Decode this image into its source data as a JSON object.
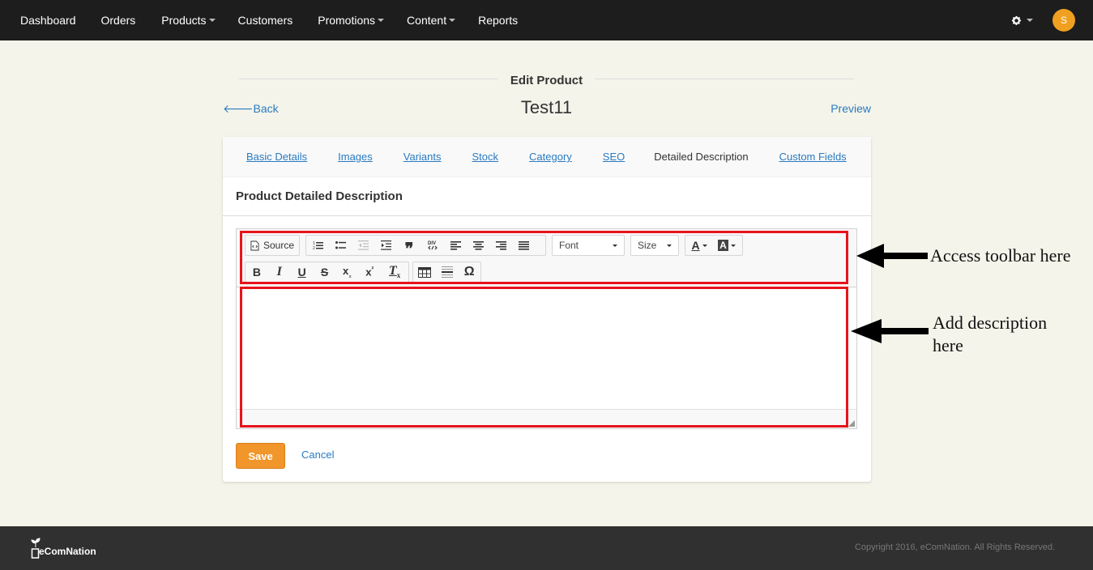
{
  "topnav": {
    "items": [
      {
        "label": "Dashboard",
        "dropdown": false
      },
      {
        "label": "Orders",
        "dropdown": false
      },
      {
        "label": "Products",
        "dropdown": true
      },
      {
        "label": "Customers",
        "dropdown": false
      },
      {
        "label": "Promotions",
        "dropdown": true
      },
      {
        "label": "Content",
        "dropdown": true
      },
      {
        "label": "Reports",
        "dropdown": false
      }
    ],
    "settings_icon": "gear-icon",
    "avatar_initial": "S",
    "avatar_color": "#f0a020"
  },
  "header": {
    "section_title": "Edit Product",
    "back_label": "Back",
    "product_name": "Test11",
    "preview_label": "Preview"
  },
  "tabs": [
    {
      "label": "Basic Details",
      "active": false
    },
    {
      "label": "Images",
      "active": false
    },
    {
      "label": "Variants",
      "active": false
    },
    {
      "label": "Stock",
      "active": false
    },
    {
      "label": "Category",
      "active": false
    },
    {
      "label": "SEO",
      "active": false
    },
    {
      "label": "Detailed Description",
      "active": true
    },
    {
      "label": "Custom Fields",
      "active": false
    }
  ],
  "panel": {
    "title": "Product Detailed Description"
  },
  "editor": {
    "source_label": "Source",
    "font_label": "Font",
    "size_label": "Size",
    "content": ""
  },
  "actions": {
    "save_label": "Save",
    "cancel_label": "Cancel",
    "save_color": "#f0962a"
  },
  "annotations": {
    "toolbar_note": "Access toolbar here",
    "description_note_line1": "Add description",
    "description_note_line2": "here",
    "highlight_color": "#e8141c"
  },
  "footer": {
    "brand": "eComNation",
    "copyright": "Copyright 2016, eComNation. All Rights Reserved."
  }
}
